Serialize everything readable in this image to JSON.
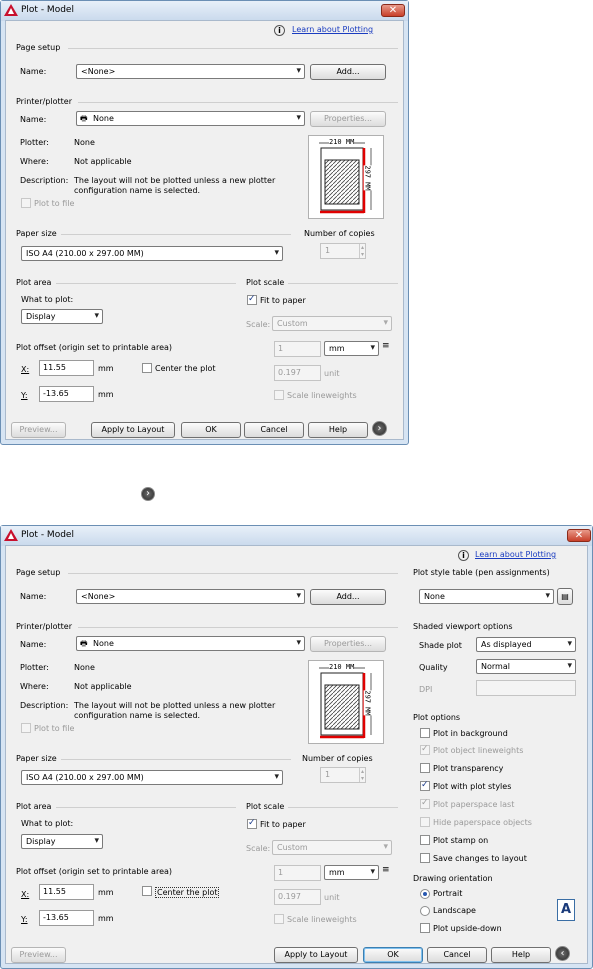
{
  "dialog": {
    "title": "Plot - Model",
    "close": "✕",
    "learn": "Learn about Plotting"
  },
  "page_setup": {
    "label": "Page setup",
    "name_label": "Name:",
    "name_value": "<None>",
    "add": "Add..."
  },
  "printer": {
    "label": "Printer/plotter",
    "name_label": "Name:",
    "name_value": "None",
    "properties": "Properties...",
    "plotter_label": "Plotter:",
    "plotter_value": "None",
    "where_label": "Where:",
    "where_value": "Not applicable",
    "desc_label": "Description:",
    "desc_value_1": "The layout will not be plotted unless a new plotter",
    "desc_value_2": "configuration name is selected.",
    "plot_to_file": "Plot to file"
  },
  "preview_fig": {
    "width": "210 MM",
    "height": "297 MM"
  },
  "paper": {
    "label": "Paper size",
    "value": "ISO A4 (210.00 x 297.00 MM)"
  },
  "copies": {
    "label": "Number of copies",
    "value": "1"
  },
  "area": {
    "label": "Plot area",
    "what": "What to plot:",
    "value": "Display"
  },
  "offset": {
    "label": "Plot offset (origin set to printable area)",
    "x_label": "X:",
    "x_value": "11.55",
    "x_unit": "mm",
    "y_label": "Y:",
    "y_value": "-13.65",
    "y_unit": "mm",
    "center": "Center the plot"
  },
  "scale": {
    "label": "Plot scale",
    "fit": "Fit to paper",
    "scale_label": "Scale:",
    "scale_value": "Custom",
    "v1": "1",
    "unit": "mm",
    "v2": "0.197",
    "unit2": "unit",
    "lineweights": "Scale lineweights"
  },
  "buttons": {
    "preview": "Preview...",
    "apply": "Apply to Layout",
    "ok": "OK",
    "cancel": "Cancel",
    "help": "Help"
  },
  "expanded": {
    "apply": "Apply to Layout",
    "more_icon": "›",
    "less_icon": "‹"
  },
  "style_table": {
    "label": "Plot style table (pen assignments)",
    "value": "None"
  },
  "viewport": {
    "label": "Shaded viewport options",
    "shade_label": "Shade plot",
    "shade_value": "As displayed",
    "quality_label": "Quality",
    "quality_value": "Normal",
    "dpi_label": "DPI"
  },
  "options": {
    "label": "Plot options",
    "items": [
      "Plot in background",
      "Plot object lineweights",
      "Plot transparency",
      "Plot with plot styles",
      "Plot paperspace last",
      "Hide paperspace objects",
      "Plot stamp on",
      "Save changes to layout"
    ]
  },
  "orientation": {
    "label": "Drawing orientation",
    "portrait": "Portrait",
    "landscape": "Landscape",
    "upside": "Plot upside-down",
    "glyph": "A"
  },
  "colors": {
    "frame": "#d6e4f3",
    "link": "#1a3cc0",
    "accent_red": "#e00000"
  }
}
